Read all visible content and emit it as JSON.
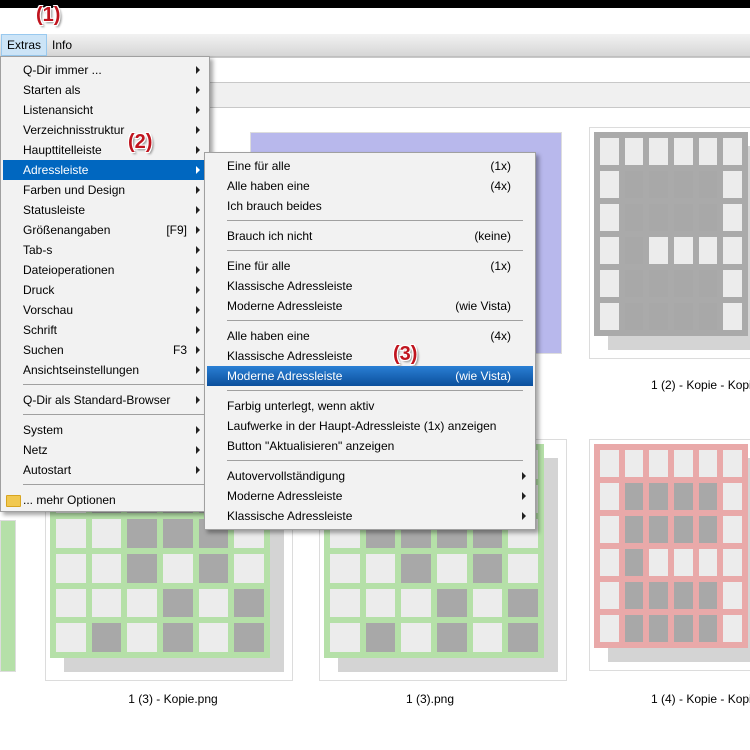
{
  "menubar": {
    "extras": "Extras",
    "info": "Info"
  },
  "annotations": [
    "(1)",
    "(2)",
    "(3)"
  ],
  "files": [
    {
      "caption": "1 (2) - Kopie - Kopi",
      "color": "#aaaaaa"
    },
    {
      "caption": "1 (3) - Kopie.png",
      "color": "#b5e0a8"
    },
    {
      "caption": "1 (3).png",
      "color": "#b5e0a8"
    },
    {
      "caption": "1 (4) - Kopie - Kopi",
      "color": "#e9a9a9"
    }
  ],
  "extras_menu": [
    {
      "label": "Q-Dir immer ...",
      "shortcut": "",
      "arrow": true
    },
    {
      "label": "Starten als",
      "shortcut": "",
      "arrow": true
    },
    {
      "label": "Listenansicht",
      "shortcut": "",
      "arrow": true
    },
    {
      "label": "Verzeichnisstruktur",
      "shortcut": "",
      "arrow": true
    },
    {
      "label": "Haupttitelleiste",
      "shortcut": "",
      "arrow": true
    },
    {
      "label": "Adressleiste",
      "shortcut": "",
      "arrow": true,
      "highlighted": true
    },
    {
      "label": "Farben und Design",
      "shortcut": "",
      "arrow": true
    },
    {
      "label": "Statusleiste",
      "shortcut": "",
      "arrow": true
    },
    {
      "label": "Größenangaben",
      "shortcut": "[F9]",
      "arrow": true
    },
    {
      "label": "Tab-s",
      "shortcut": "",
      "arrow": true
    },
    {
      "label": "Dateioperationen",
      "shortcut": "",
      "arrow": true
    },
    {
      "label": "Druck",
      "shortcut": "",
      "arrow": true
    },
    {
      "label": "Vorschau",
      "shortcut": "",
      "arrow": true
    },
    {
      "label": "Schrift",
      "shortcut": "",
      "arrow": true
    },
    {
      "label": "Suchen",
      "shortcut": "F3",
      "arrow": true
    },
    {
      "label": "Ansichtseinstellungen",
      "shortcut": "",
      "arrow": true
    },
    {
      "separator": true
    },
    {
      "label": "Q-Dir als Standard-Browser",
      "shortcut": "",
      "arrow": true
    },
    {
      "separator": true
    },
    {
      "label": "System",
      "shortcut": "",
      "arrow": true
    },
    {
      "label": "Netz",
      "shortcut": "",
      "arrow": true
    },
    {
      "label": "Autostart",
      "shortcut": "",
      "arrow": true
    },
    {
      "separator": true
    },
    {
      "label": "... mehr Optionen",
      "shortcut": "",
      "arrow": false,
      "icon": "folder-icon"
    }
  ],
  "adress_submenu": [
    {
      "label": "Eine für alle",
      "shortcut": "(1x)"
    },
    {
      "label": "Alle haben eine",
      "shortcut": "(4x)"
    },
    {
      "label": "Ich brauch beides",
      "shortcut": ""
    },
    {
      "separator": true
    },
    {
      "label": "Brauch ich nicht",
      "shortcut": "(keine)"
    },
    {
      "separator": true
    },
    {
      "label": "Eine für alle",
      "shortcut": "(1x)"
    },
    {
      "label": "Klassische Adressleiste",
      "shortcut": ""
    },
    {
      "label": "Moderne Adressleiste",
      "shortcut": "(wie Vista)"
    },
    {
      "separator": true
    },
    {
      "label": "Alle haben eine",
      "shortcut": "(4x)"
    },
    {
      "label": "Klassische Adressleiste",
      "shortcut": ""
    },
    {
      "label": "Moderne Adressleiste",
      "shortcut": "(wie Vista)",
      "highlighted": true
    },
    {
      "separator": true
    },
    {
      "label": "Farbig unterlegt, wenn aktiv",
      "shortcut": ""
    },
    {
      "label": "Laufwerke in der Haupt-Adressleiste (1x) anzeigen",
      "shortcut": ""
    },
    {
      "label": "Button \"Aktualisieren\" anzeigen",
      "shortcut": ""
    },
    {
      "separator": true
    },
    {
      "label": "Autovervollständigung",
      "shortcut": "",
      "arrow": true
    },
    {
      "label": "Moderne Adressleiste",
      "shortcut": "",
      "arrow": true
    },
    {
      "label": "Klassische Adressleiste",
      "shortcut": "",
      "arrow": true
    }
  ]
}
